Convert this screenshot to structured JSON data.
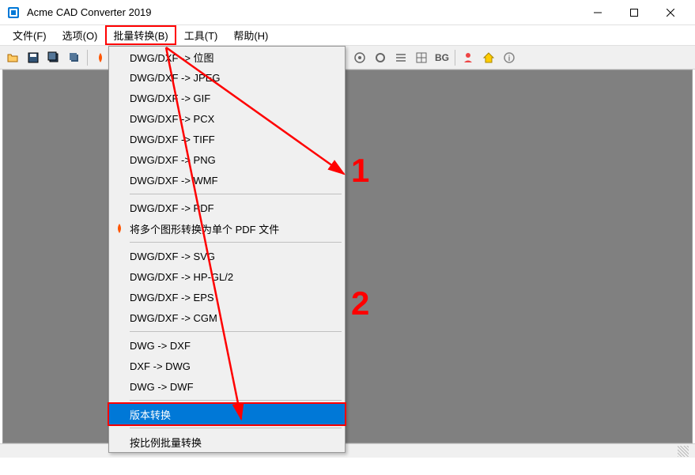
{
  "titlebar": {
    "title": "Acme CAD Converter 2019"
  },
  "menubar": {
    "file": "文件(F)",
    "options": "选项(O)",
    "batch": "批量转换(B)",
    "tools": "工具(T)",
    "help": "帮助(H)"
  },
  "dropdown": {
    "items": [
      "DWG/DXF -> 位图",
      "DWG/DXF -> JPEG",
      "DWG/DXF -> GIF",
      "DWG/DXF -> PCX",
      "DWG/DXF -> TIFF",
      "DWG/DXF -> PNG",
      "DWG/DXF -> WMF"
    ],
    "group2": [
      "DWG/DXF -> PDF",
      "将多个图形转换为单个 PDF 文件"
    ],
    "group3": [
      "DWG/DXF -> SVG",
      "DWG/DXF -> HP-GL/2",
      "DWG/DXF -> EPS",
      "DWG/DXF -> CGM"
    ],
    "group4": [
      "DWG -> DXF",
      "DXF -> DWG",
      "DWG -> DWF"
    ],
    "version_convert": "版本转换",
    "scale_batch": "按比例批量转换"
  },
  "toolbar": {
    "bg_label": "BG"
  },
  "annotations": {
    "num1": "1",
    "num2": "2"
  }
}
